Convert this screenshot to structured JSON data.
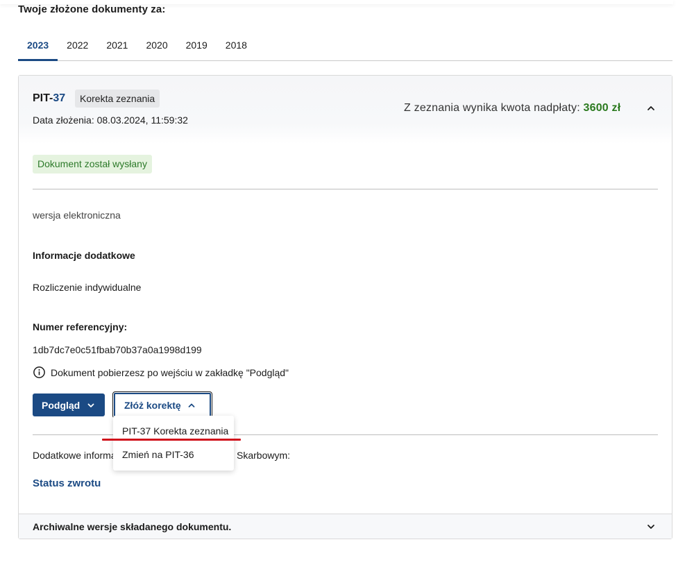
{
  "section_title": "Twoje złożone dokumenty za:",
  "tabs": [
    {
      "label": "2023",
      "active": true
    },
    {
      "label": "2022",
      "active": false
    },
    {
      "label": "2021",
      "active": false
    },
    {
      "label": "2020",
      "active": false
    },
    {
      "label": "2019",
      "active": false
    },
    {
      "label": "2018",
      "active": false
    }
  ],
  "document": {
    "type_prefix": "PIT-",
    "type_number": "37",
    "kind_badge": "Korekta zeznania",
    "submission_date": "Data złożenia: 08.03.2024, 11:59:32",
    "overpayment_text": "Z zeznania wynika kwota nadpłaty:",
    "overpayment_amount": "3600 zł",
    "status_badge": "Dokument został wysłany",
    "version": "wersja elektroniczna",
    "additional_info_heading": "Informacje dodatkowe",
    "settlement_type": "Rozliczenie indywidualne",
    "reference_label": "Numer referencyjny:",
    "reference_value": "1db7dc7e0c51fbab70b37a0a1998d199",
    "download_hint": "Dokument pobierzesz po wejściu w zakładkę \"Podgląd\"",
    "preview_button": "Podgląd",
    "correction_button": "Złóż korektę",
    "extra_info_start": "Dodatkowe informa",
    "extra_info_end": "Skarbowym:",
    "status_link": "Status zwrotu",
    "archive_label": "Archiwalne wersje składanego dokumentu."
  },
  "correction_menu": {
    "items": [
      {
        "label": "PIT-37 Korekta zeznania"
      },
      {
        "label": "Zmień na PIT-36"
      }
    ]
  },
  "colors": {
    "primary": "#1b4a84",
    "success_text": "#2d7a2a",
    "amount": "#2b7a1f",
    "highlight_underline": "#d0101b"
  },
  "icons": {
    "collapse": "chevron-up-icon",
    "expand": "chevron-down-icon",
    "info": "info-circle-icon"
  }
}
